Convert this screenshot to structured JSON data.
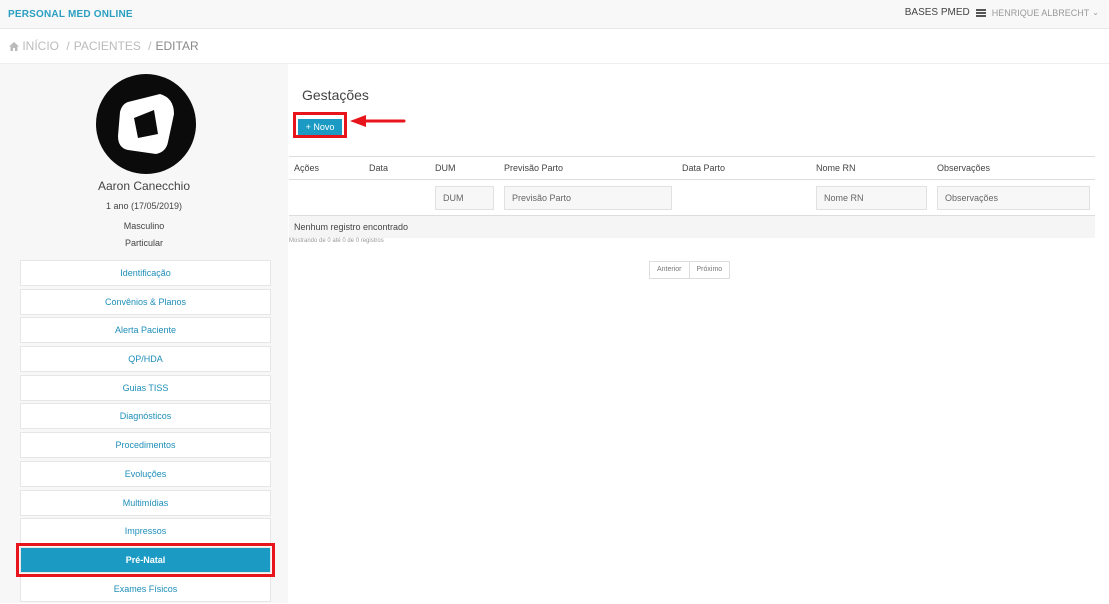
{
  "app": {
    "brand": "PERSONAL MED ONLINE"
  },
  "header": {
    "bases": "BASES PMED",
    "user": "HENRIQUE ALBRECHT",
    "menu_icon": "hamburger-icon",
    "dropdown_icon": "chevron-down-icon"
  },
  "breadcrumb": {
    "home_icon": "home-icon",
    "items": [
      "INÍCIO",
      "PACIENTES",
      "EDITAR"
    ],
    "separator": "/"
  },
  "patient": {
    "name": "Aaron Canecchio",
    "age": "1 ano (17/05/2019)",
    "sex": "Masculino",
    "plan": "Particular"
  },
  "menu": {
    "items": [
      "Identificação",
      "Convênios & Planos",
      "Alerta Paciente",
      "QP/HDA",
      "Guias TISS",
      "Diagnósticos",
      "Procedimentos",
      "Evoluções",
      "Multimídias",
      "Impressos",
      "Pré-Natal",
      "Exames Físicos"
    ],
    "active": "Pré-Natal"
  },
  "main": {
    "title": "Gestações",
    "new_button": "+ Novo",
    "columns": [
      "Ações",
      "Data",
      "DUM",
      "Previsão Parto",
      "Data Parto",
      "Nome RN",
      "Observações"
    ],
    "filters": {
      "dum": "DUM",
      "previsao": "Previsão Parto",
      "nome_rn": "Nome RN",
      "observacoes": "Observações"
    },
    "empty_text": "Nenhum registro encontrado",
    "showing_text": "Mostrando de 0 até 0 de 0 registros",
    "pager": {
      "prev": "Anterior",
      "next": "Próximo"
    }
  },
  "colors": {
    "accent": "#1b9bc4",
    "highlight": "#e8141b",
    "brand": "#2a9fc2"
  }
}
